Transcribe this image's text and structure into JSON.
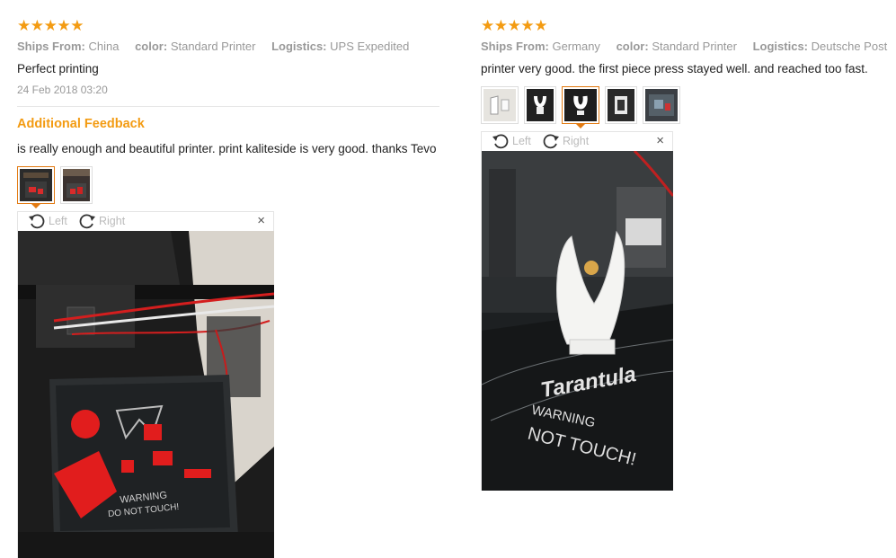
{
  "accent_color": "#f39b12",
  "rating_icon": "star-icon",
  "left_review": {
    "stars": 5,
    "ships_from_label": "Ships From:",
    "ships_from": "China",
    "color_label": "color:",
    "color": "Standard Printer",
    "logistics_label": "Logistics:",
    "logistics": "UPS Expedited",
    "text": "Perfect printing",
    "date": "24 Feb 2018 03:20",
    "additional_title": "Additional Feedback",
    "additional_text": "is really enough and beautiful printer. print kaliteside is very good. thanks Tevo",
    "viewer": {
      "left_label": "Left",
      "right_label": "Right",
      "close_label": "×"
    },
    "photo_text": {
      "warning": "WARNING",
      "touch": "DO NOT TOUCH!"
    }
  },
  "right_review": {
    "stars": 5,
    "ships_from_label": "Ships From:",
    "ships_from": "Germany",
    "color_label": "color:",
    "color": "Standard Printer",
    "logistics_label": "Logistics:",
    "logistics": "Deutsche Post",
    "text": "printer very good. the first piece press stayed well. and reached too fast.",
    "viewer": {
      "left_label": "Left",
      "right_label": "Right",
      "close_label": "×"
    },
    "photo_text": {
      "brand": "Tarantula",
      "warning": "WARNING",
      "touch": "NOT TOUCH!"
    }
  }
}
